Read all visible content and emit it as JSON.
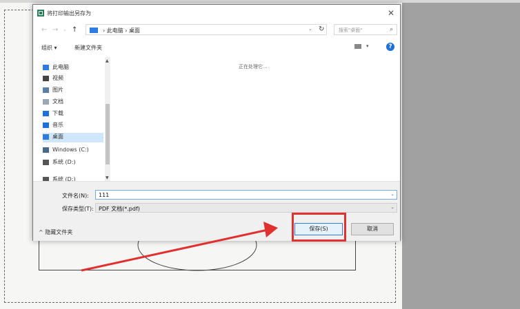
{
  "dialog": {
    "title": "将打印输出另存为",
    "close_icon": "close-icon"
  },
  "address": {
    "back_icon": "←",
    "forward_icon": "→",
    "recent_icon": "⌄",
    "up_icon": "↑",
    "breadcrumb": "› 此电脑 › 桌面",
    "search_placeholder": "搜索\"桌面\""
  },
  "toolbar": {
    "organize": "组织 ▾",
    "new_folder": "新建文件夹"
  },
  "sidebar": {
    "items": [
      {
        "label": "此电脑",
        "icon": "computer-icon",
        "color": "#2f7be0"
      },
      {
        "label": "视频",
        "icon": "video-icon",
        "color": "#444444"
      },
      {
        "label": "图片",
        "icon": "pictures-icon",
        "color": "#5a7fa8"
      },
      {
        "label": "文档",
        "icon": "documents-icon",
        "color": "#9aa7b5"
      },
      {
        "label": "下载",
        "icon": "download-icon",
        "color": "#1e6fd9"
      },
      {
        "label": "音乐",
        "icon": "music-icon",
        "color": "#1e6fd9"
      },
      {
        "label": "桌面",
        "icon": "desktop-icon",
        "color": "#2f7be0"
      },
      {
        "label": "Windows (C:)",
        "icon": "drive-icon",
        "color": "#4a6a8a"
      },
      {
        "label": "系统 (D:)",
        "icon": "drive-icon",
        "color": "#555555"
      },
      {
        "label": "系统 (D:)",
        "icon": "drive-icon",
        "color": "#555555"
      }
    ]
  },
  "content": {
    "status": "正在处理它..."
  },
  "form": {
    "filename_label": "文件名(N):",
    "filename_value": "111",
    "filetype_label": "保存类型(T):",
    "filetype_value": "PDF 文档(*.pdf)"
  },
  "footer": {
    "hide_folders": "^ 隐藏文件夹",
    "save_label": "保存(S)",
    "cancel_label": "取消"
  },
  "colors": {
    "highlight": "#e03131",
    "accent": "#2f7be0"
  }
}
